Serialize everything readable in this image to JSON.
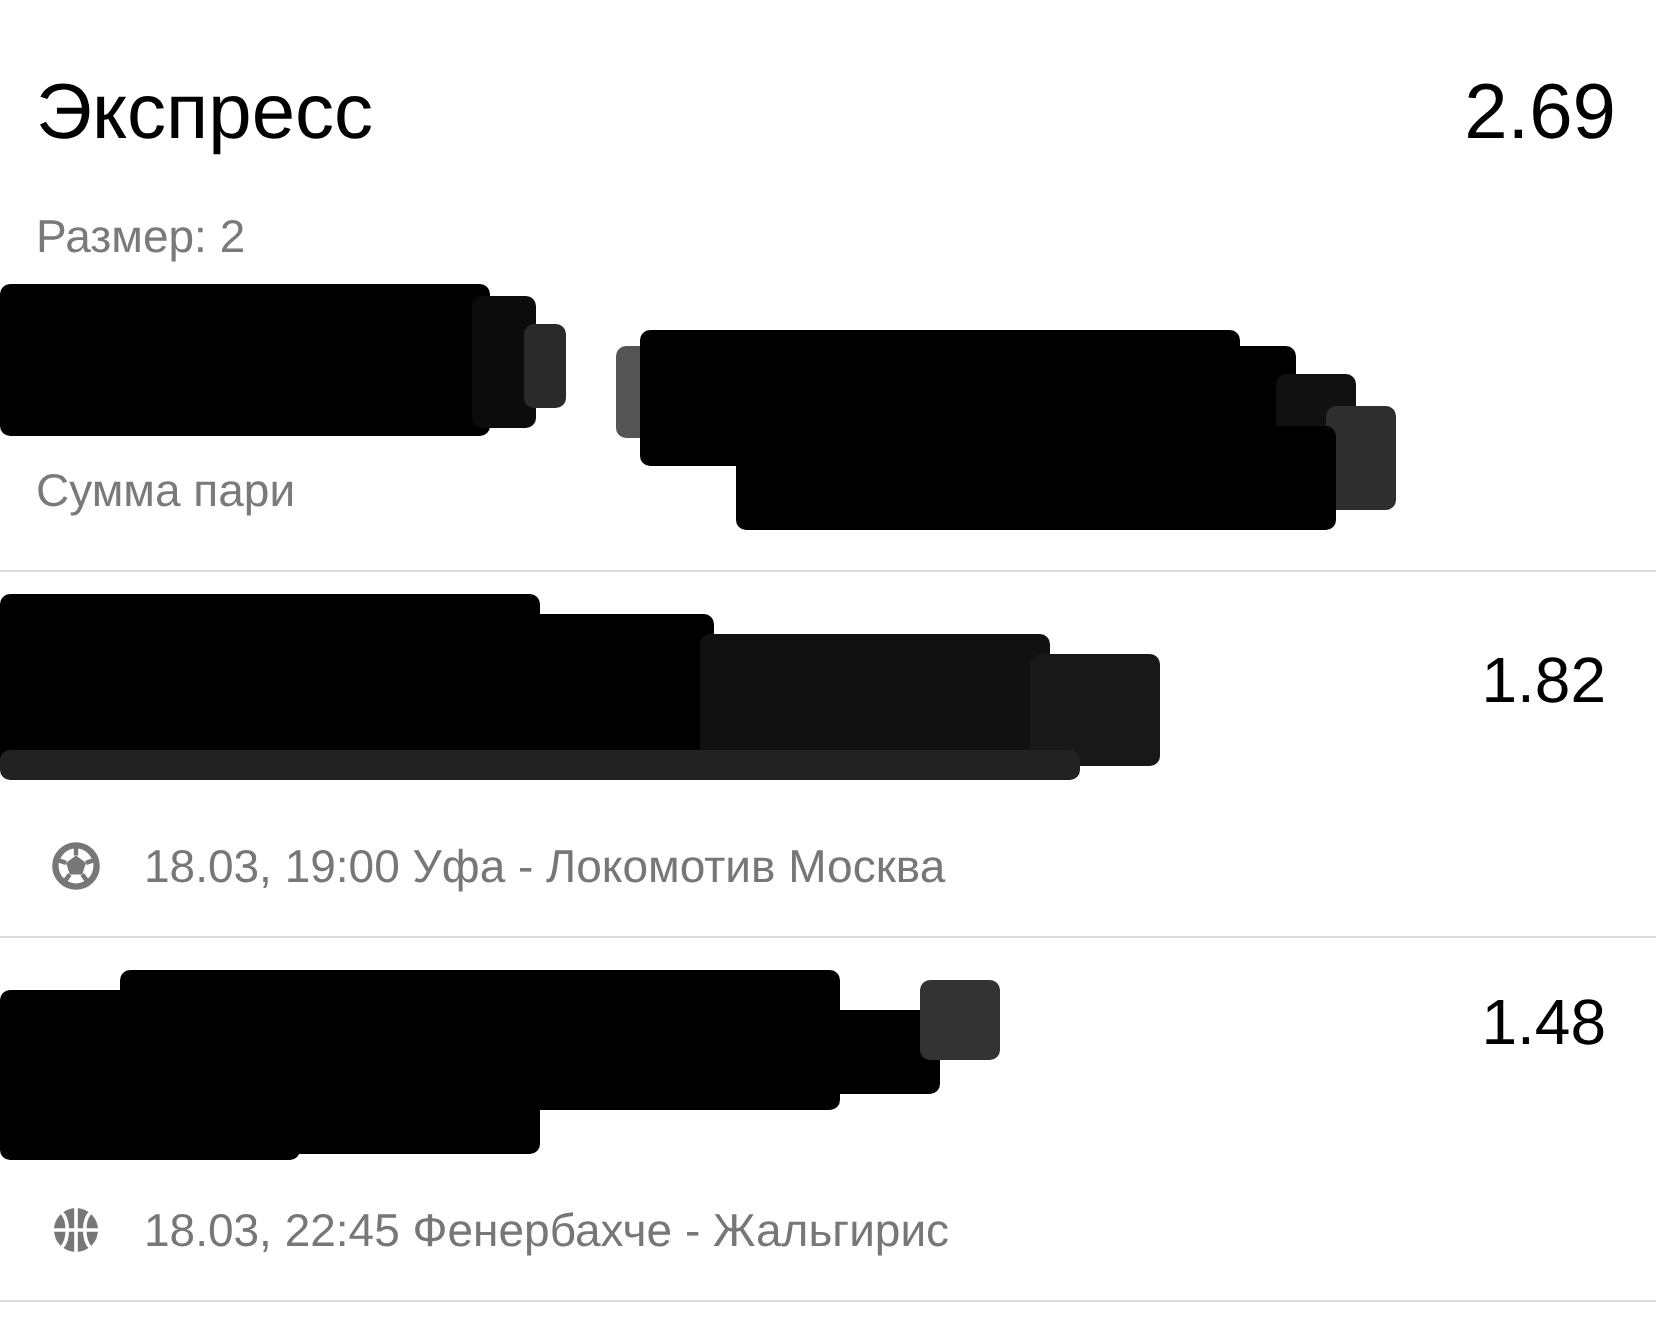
{
  "header": {
    "title": "Экспресс",
    "odds": "2.69",
    "size_label": "Размер: 2",
    "stake_label": "Сумма пари"
  },
  "bets": [
    {
      "kind": "football",
      "odds": "1.82",
      "event": "18.03, 19:00 Уфа - Локомотив Москва"
    },
    {
      "kind": "basketball",
      "odds": "1.48",
      "event": "18.03, 22:45 Фенербахче - Жальгирис"
    }
  ]
}
